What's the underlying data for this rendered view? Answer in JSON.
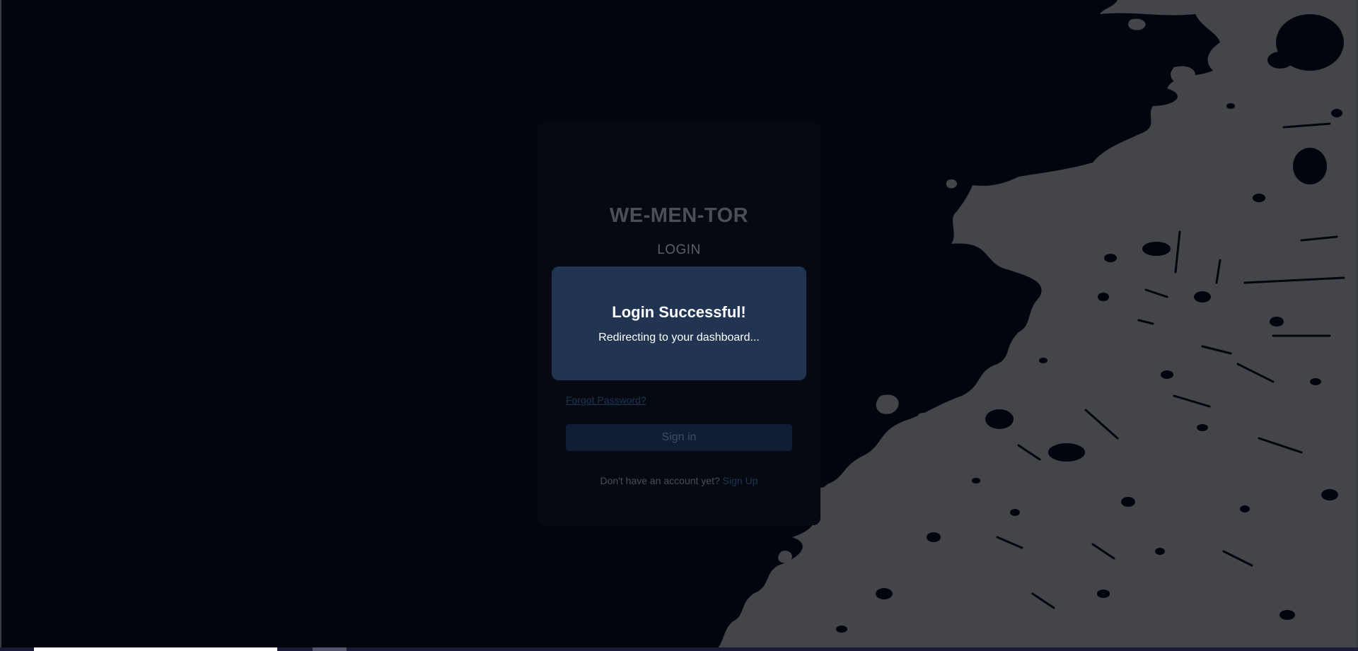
{
  "brand": {
    "title": "WE-MEN-TOR"
  },
  "login": {
    "heading": "LOGIN",
    "forgot_password": "Forgot Password?",
    "signin_label": "Sign in",
    "no_account_text": "Don't have an account yet?",
    "signup_label": "Sign Up"
  },
  "modal": {
    "title": "Login Successful!",
    "message": "Redirecting to your dashboard..."
  },
  "colors": {
    "background": "#02050c",
    "splatter": "#44454a",
    "card": "#050a12",
    "modal": "#213553",
    "button": "#0f1e33",
    "link": "#1f3552"
  }
}
